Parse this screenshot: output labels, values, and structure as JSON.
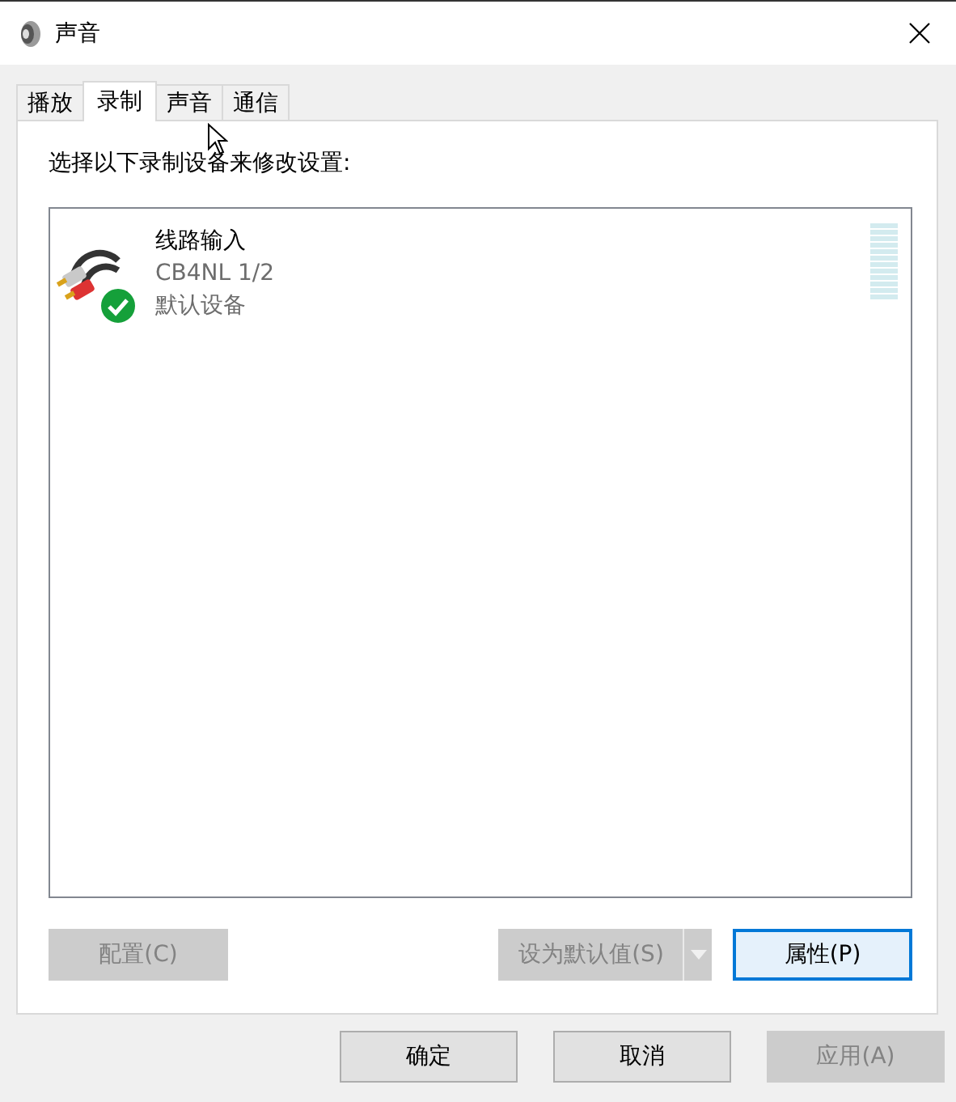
{
  "window": {
    "title": "声音"
  },
  "tabs": [
    {
      "label": "播放",
      "selected": false
    },
    {
      "label": "录制",
      "selected": true
    },
    {
      "label": "声音",
      "selected": false
    },
    {
      "label": "通信",
      "selected": false
    }
  ],
  "instruction": "选择以下录制设备来修改设置:",
  "devices": [
    {
      "name": "线路输入",
      "detail": "CB4NL 1/2",
      "status": "默认设备",
      "is_default": true,
      "selected": false
    }
  ],
  "device_buttons": [
    {
      "label": "配置(C)",
      "disabled": true,
      "kind": "plain"
    },
    {
      "label": "设为默认值(S)",
      "disabled": true,
      "kind": "split"
    },
    {
      "label": "属性(P)",
      "disabled": false,
      "kind": "focused"
    }
  ],
  "dialog_buttons": [
    {
      "label": "确定",
      "disabled": false
    },
    {
      "label": "取消",
      "disabled": false
    },
    {
      "label": "应用(A)",
      "disabled": true
    }
  ]
}
